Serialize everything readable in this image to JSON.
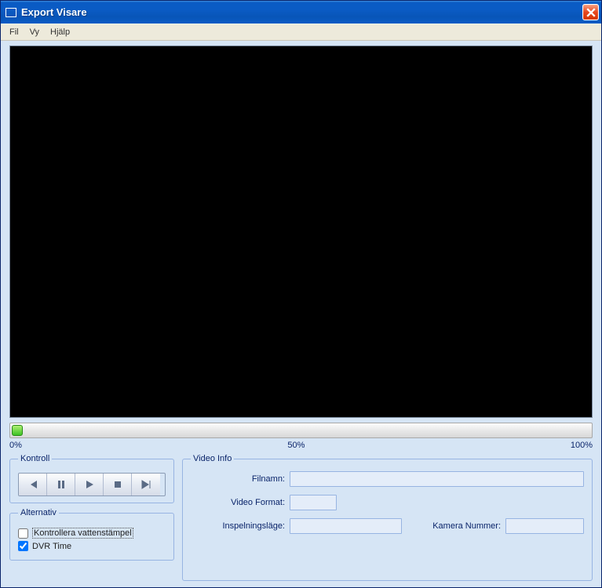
{
  "window": {
    "title": "Export Visare"
  },
  "menubar": {
    "items": [
      "Fil",
      "Vy",
      "Hjälp"
    ]
  },
  "progress": {
    "labels": [
      "0%",
      "50%",
      "100%"
    ]
  },
  "kontroll": {
    "legend": "Kontroll"
  },
  "alternativ": {
    "legend": "Alternativ",
    "watermark_label": "Kontrollera vattenstämpel",
    "watermark_checked": false,
    "dvrtime_label": "DVR Time",
    "dvrtime_checked": true
  },
  "videoinfo": {
    "legend": "Video Info",
    "filnamn_label": "Filnamn:",
    "filnamn_value": "",
    "videoformat_label": "Video Format:",
    "videoformat_value": "",
    "inspelningslage_label": "Inspelningsläge:",
    "inspelningslage_value": "",
    "kameranummer_label": "Kamera Nummer:",
    "kameranummer_value": ""
  }
}
